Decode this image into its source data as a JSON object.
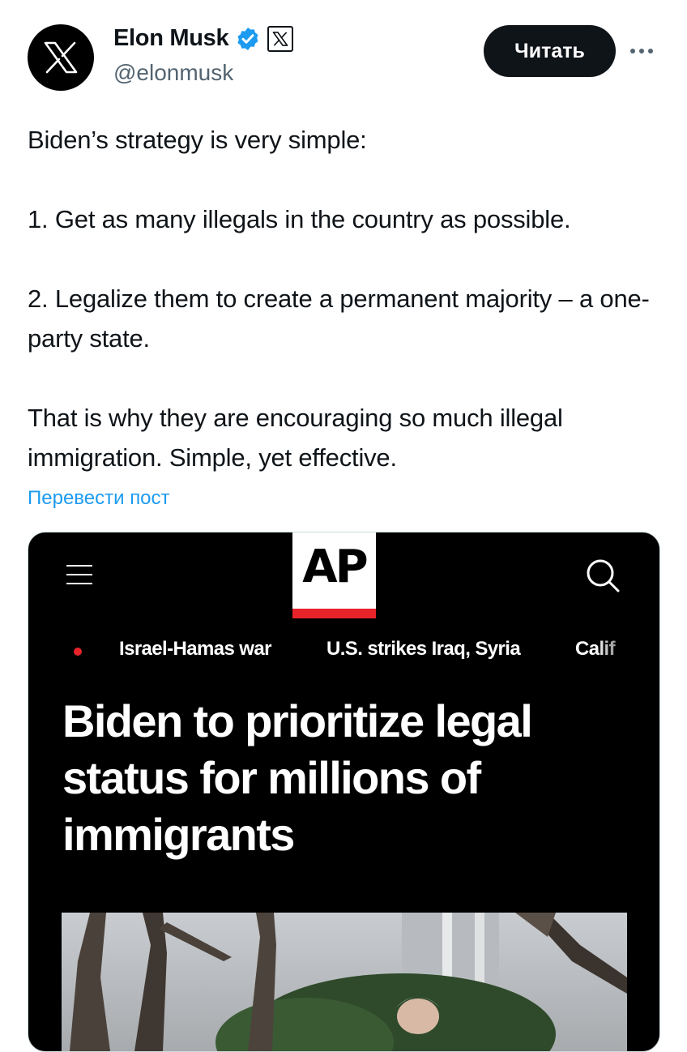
{
  "author": {
    "name": "Elon Musk",
    "handle": "@elonmusk",
    "verified_badge": "verified-badge-icon",
    "affiliate_badge": "x-logo-icon"
  },
  "actions": {
    "follow_label": "Читать",
    "more_icon": "more-horizontal-icon"
  },
  "tweet": {
    "text": "Biden’s strategy is very simple:\n\n1. Get as many illegals in the country as possible.\n\n2. Legalize them to create a permanent majority – a one-party state.\n\nThat is why they are encouraging so much illegal immigration. Simple, yet effective.",
    "translate_label": "Перевести пост"
  },
  "card": {
    "logo_text": "AP",
    "nav_links": [
      "Israel-Hamas war",
      "U.S. strikes Iraq, Syria",
      "Calif"
    ],
    "headline": "Biden to prioritize legal status for millions of immigrants",
    "photo_alt": "article-photo"
  },
  "colors": {
    "accent": "#1d9bf0",
    "ap_red": "#e8232a",
    "text_primary": "#0f1419",
    "text_secondary": "#536471"
  }
}
